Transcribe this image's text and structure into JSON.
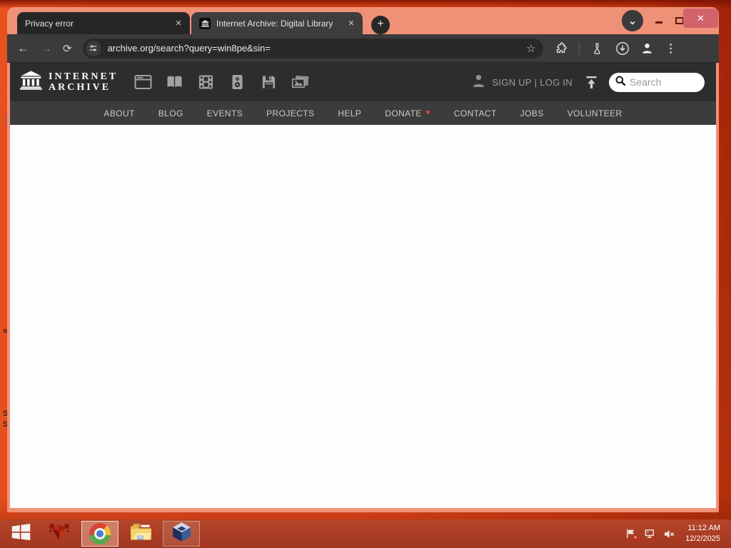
{
  "colors": {
    "desktop_orange": "#e24818",
    "window_frame_salmon": "#ee9177",
    "close_button_red": "#d2636b",
    "toolbar_gray": "#3b3b3b",
    "ia_header_gray": "#2d2d2d",
    "ia_nav_gray": "#3c3c3c",
    "donate_heart_red": "#f0413b",
    "taskbar_red": "#a93d22"
  },
  "glyphs": {
    "close": "✕",
    "plus": "+",
    "back": "←",
    "forward": "→",
    "reload": "⟳",
    "star": "☆",
    "overflow_dots": "⋮",
    "heart": "♥",
    "chevron_down": "⌄",
    "badge_x": "✕"
  },
  "browser": {
    "tabs": [
      {
        "title": "Privacy error"
      },
      {
        "title": "Internet Archive: Digital Library"
      }
    ],
    "address": {
      "url": "archive.org/search?query=win8pe&sin="
    }
  },
  "archive_header": {
    "logo_line1": "INTERNET",
    "logo_line2": "ARCHIVE",
    "auth": "SIGN UP | LOG IN",
    "search_placeholder": "Search"
  },
  "nav": {
    "items": [
      "ABOUT",
      "BLOG",
      "EVENTS",
      "PROJECTS",
      "HELP",
      "DONATE",
      "CONTACT",
      "JOBS",
      "VOLUNTEER"
    ]
  },
  "taskbar": {
    "clock": {
      "time": "11:12 AM",
      "date": "12/2/2025"
    }
  },
  "desktop": {
    "icon_label_fragments": [
      "s",
      "S",
      "S"
    ]
  },
  "icons": [
    "archive-logo-icon",
    "web-icon",
    "texts-icon",
    "video-icon",
    "audio-icon",
    "software-icon",
    "images-icon",
    "person-icon",
    "upload-icon",
    "search-icon",
    "site-settings-icon",
    "bookmark-star-icon",
    "extensions-icon",
    "labs-flask-icon",
    "download-icon",
    "profile-icon",
    "menu-dots-icon",
    "windows-start-icon",
    "red-diamond-app-icon",
    "chrome-icon",
    "file-explorer-icon",
    "virtualbox-icon",
    "action-center-flag-icon",
    "network-icon",
    "volume-muted-icon"
  ]
}
